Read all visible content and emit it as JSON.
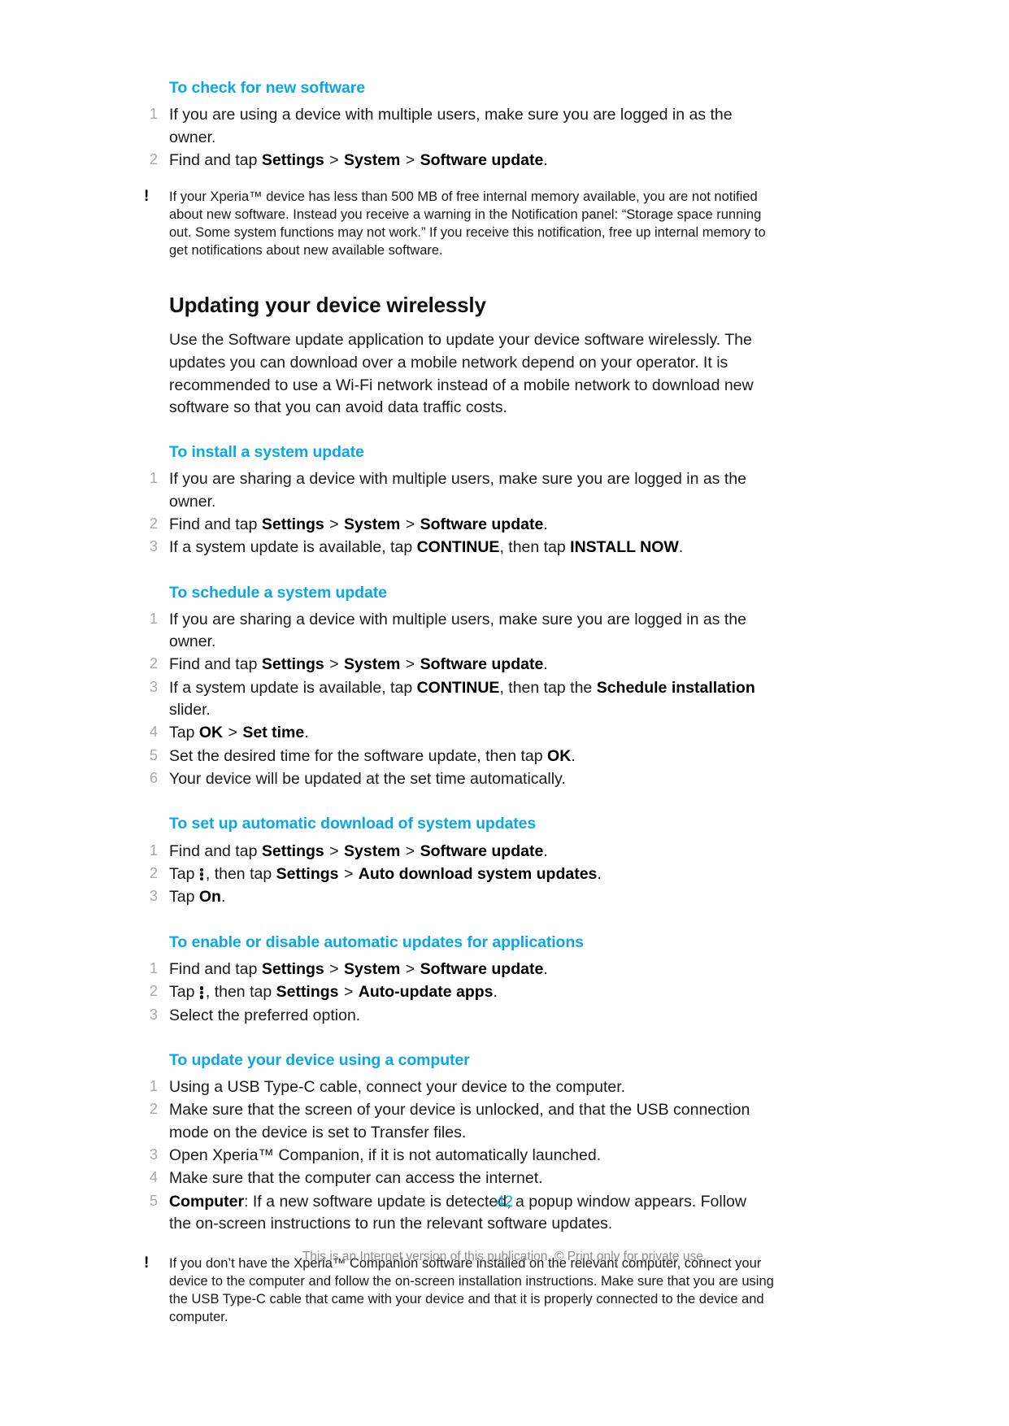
{
  "document": {
    "page_number": "42",
    "footer_note": "This is an Internet version of this publication. © Print only for private use.",
    "accent_color": "#0aa7e8",
    "menu_icon": "vertical-three-dots-icon"
  },
  "sections": {
    "check_new_software": {
      "heading": "To check for new software",
      "steps": [
        {
          "num": "1",
          "parts": [
            {
              "t": "If you are using a device with multiple users, make sure you are logged in as the owner."
            }
          ]
        },
        {
          "num": "2",
          "parts": [
            {
              "t": "Find and tap "
            },
            {
              "t": "Settings",
              "b": true
            },
            {
              "t": " > "
            },
            {
              "t": "System",
              "b": true
            },
            {
              "t": " > "
            },
            {
              "t": "Software update",
              "b": true
            },
            {
              "t": "."
            }
          ]
        }
      ],
      "note": "If your Xperia™ device has less than 500 MB of free internal memory available, you are not notified about new software. Instead you receive a warning in the Notification panel: “Storage space running out. Some system functions may not work.” If you receive this notification, free up internal memory to get notifications about new available software."
    },
    "updating_wirelessly": {
      "heading": "Updating your device wirelessly",
      "intro": "Use the Software update application to update your device software wirelessly. The updates you can download over a mobile network depend on your operator. It is recommended to use a Wi-Fi network instead of a mobile network to download new software so that you can avoid data traffic costs."
    },
    "install_system_update": {
      "heading": "To install a system update",
      "steps": [
        {
          "num": "1",
          "parts": [
            {
              "t": "If you are sharing a device with multiple users, make sure you are logged in as the owner."
            }
          ]
        },
        {
          "num": "2",
          "parts": [
            {
              "t": "Find and tap "
            },
            {
              "t": "Settings",
              "b": true
            },
            {
              "t": " > "
            },
            {
              "t": "System",
              "b": true
            },
            {
              "t": " > "
            },
            {
              "t": "Software update",
              "b": true
            },
            {
              "t": "."
            }
          ]
        },
        {
          "num": "3",
          "parts": [
            {
              "t": "If a system update is available, tap "
            },
            {
              "t": "CONTINUE",
              "b": true
            },
            {
              "t": ", then tap "
            },
            {
              "t": "INSTALL NOW",
              "b": true
            },
            {
              "t": "."
            }
          ]
        }
      ]
    },
    "schedule_system_update": {
      "heading": "To schedule a system update",
      "steps": [
        {
          "num": "1",
          "parts": [
            {
              "t": "If you are sharing a device with multiple users, make sure you are logged in as the owner."
            }
          ]
        },
        {
          "num": "2",
          "parts": [
            {
              "t": "Find and tap "
            },
            {
              "t": "Settings",
              "b": true
            },
            {
              "t": " > "
            },
            {
              "t": "System",
              "b": true
            },
            {
              "t": " > "
            },
            {
              "t": "Software update",
              "b": true
            },
            {
              "t": "."
            }
          ]
        },
        {
          "num": "3",
          "parts": [
            {
              "t": "If a system update is available, tap "
            },
            {
              "t": "CONTINUE",
              "b": true
            },
            {
              "t": ", then tap the "
            },
            {
              "t": "Schedule installation",
              "b": true
            },
            {
              "t": " slider."
            }
          ]
        },
        {
          "num": "4",
          "parts": [
            {
              "t": "Tap "
            },
            {
              "t": "OK",
              "b": true
            },
            {
              "t": " > "
            },
            {
              "t": "Set time",
              "b": true
            },
            {
              "t": "."
            }
          ]
        },
        {
          "num": "5",
          "parts": [
            {
              "t": "Set the desired time for the software update, then tap "
            },
            {
              "t": "OK",
              "b": true
            },
            {
              "t": "."
            }
          ]
        },
        {
          "num": "6",
          "parts": [
            {
              "t": "Your device will be updated at the set time automatically."
            }
          ]
        }
      ]
    },
    "auto_download": {
      "heading": "To set up automatic download of system updates",
      "steps": [
        {
          "num": "1",
          "parts": [
            {
              "t": "Find and tap "
            },
            {
              "t": "Settings",
              "b": true
            },
            {
              "t": " > "
            },
            {
              "t": "System",
              "b": true
            },
            {
              "t": " > "
            },
            {
              "t": "Software update",
              "b": true
            },
            {
              "t": "."
            }
          ]
        },
        {
          "num": "2",
          "parts": [
            {
              "t": "Tap "
            },
            {
              "icon": "vertical-three-dots-icon"
            },
            {
              "t": ", then tap "
            },
            {
              "t": "Settings",
              "b": true
            },
            {
              "t": " > "
            },
            {
              "t": "Auto download system updates",
              "b": true
            },
            {
              "t": "."
            }
          ]
        },
        {
          "num": "3",
          "parts": [
            {
              "t": "Tap "
            },
            {
              "t": "On",
              "b": true
            },
            {
              "t": "."
            }
          ]
        }
      ]
    },
    "auto_update_apps": {
      "heading": "To enable or disable automatic updates for applications",
      "steps": [
        {
          "num": "1",
          "parts": [
            {
              "t": "Find and tap "
            },
            {
              "t": "Settings",
              "b": true
            },
            {
              "t": " > "
            },
            {
              "t": "System",
              "b": true
            },
            {
              "t": " > "
            },
            {
              "t": "Software update",
              "b": true
            },
            {
              "t": "."
            }
          ]
        },
        {
          "num": "2",
          "parts": [
            {
              "t": "Tap "
            },
            {
              "icon": "vertical-three-dots-icon"
            },
            {
              "t": ", then tap "
            },
            {
              "t": "Settings",
              "b": true
            },
            {
              "t": " > "
            },
            {
              "t": "Auto-update apps",
              "b": true
            },
            {
              "t": "."
            }
          ]
        },
        {
          "num": "3",
          "parts": [
            {
              "t": "Select the preferred option."
            }
          ]
        }
      ]
    },
    "update_using_computer": {
      "heading": "To update your device using a computer",
      "steps": [
        {
          "num": "1",
          "parts": [
            {
              "t": "Using a USB Type-C cable, connect your device to the computer."
            }
          ]
        },
        {
          "num": "2",
          "parts": [
            {
              "t": "Make sure that the screen of your device is unlocked, and that the USB connection mode on the device is set to Transfer files."
            }
          ]
        },
        {
          "num": "3",
          "parts": [
            {
              "t": "Open Xperia™ Companion, if it is not automatically launched."
            }
          ]
        },
        {
          "num": "4",
          "parts": [
            {
              "t": "Make sure that the computer can access the internet."
            }
          ]
        },
        {
          "num": "5",
          "parts": [
            {
              "t": "Computer",
              "b": true
            },
            {
              "t": ": If a new software update is detected, a popup window appears. Follow the on-screen instructions to run the relevant software updates."
            }
          ]
        }
      ],
      "note": "If you don’t have the Xperia™ Companion software installed on the relevant computer, connect your device to the computer and follow the on-screen installation instructions. Make sure that you are using the USB Type-C cable that came with your device and that it is properly connected to the device and computer."
    }
  }
}
